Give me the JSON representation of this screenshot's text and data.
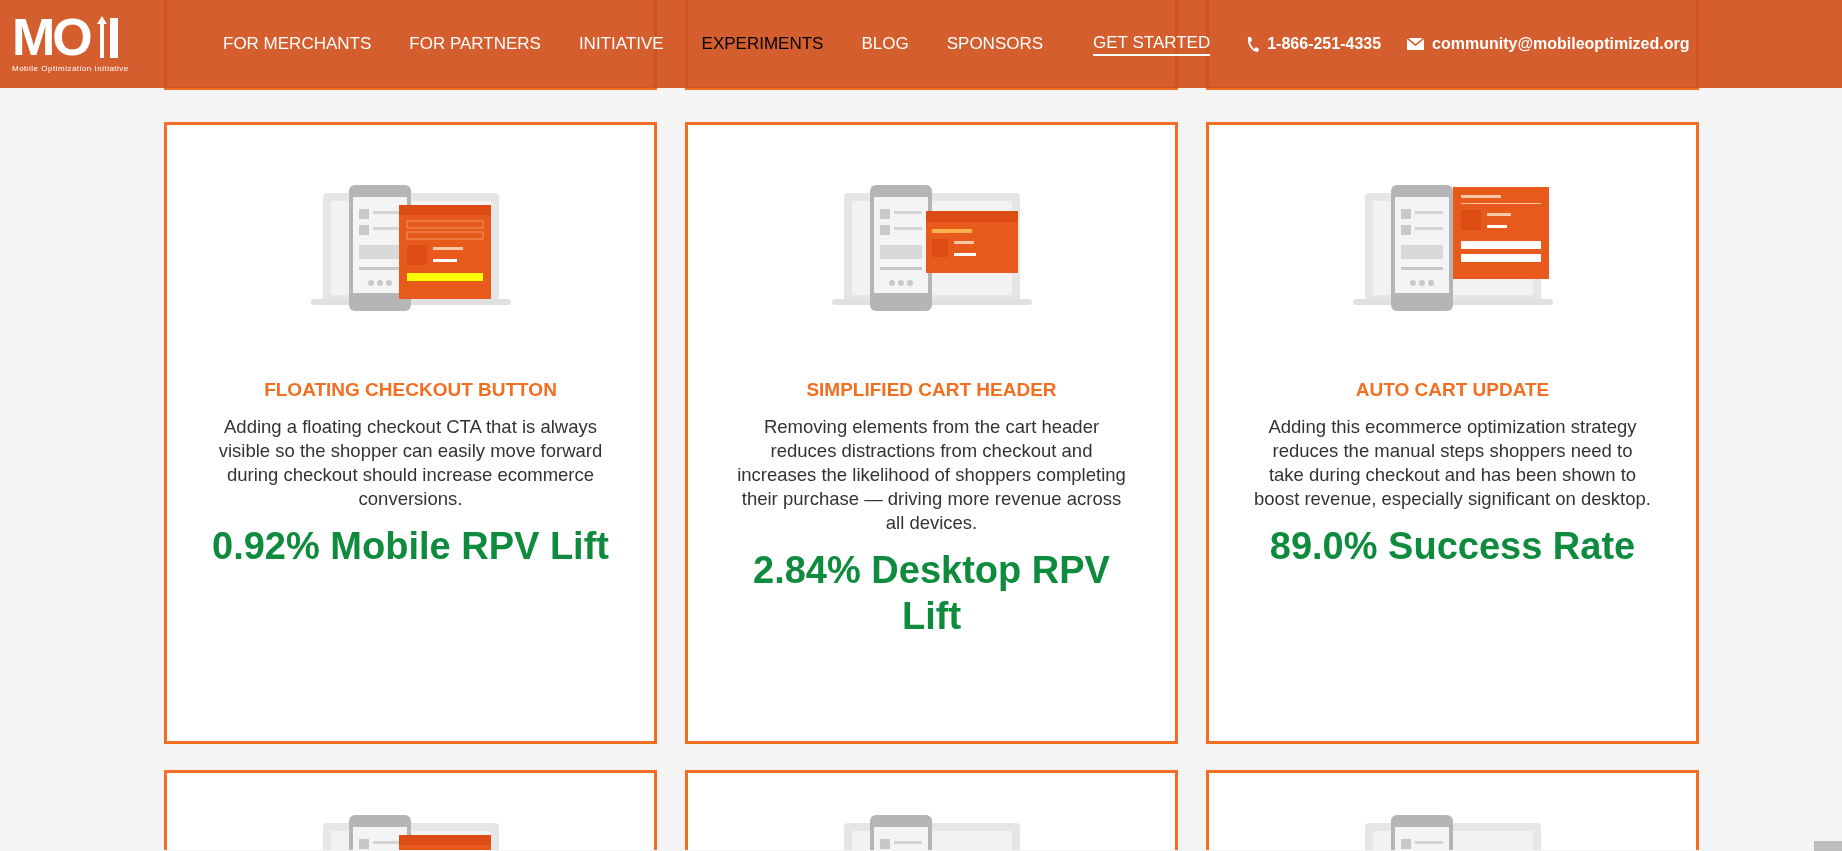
{
  "header": {
    "logo": {
      "wordmark": "MO",
      "tagline": "Mobile Optimization Initiative"
    },
    "nav": [
      {
        "label": "FOR MERCHANTS",
        "kind": "link",
        "selected": false
      },
      {
        "label": "FOR PARTNERS",
        "kind": "link",
        "selected": false
      },
      {
        "label": "INITIATIVE",
        "kind": "link",
        "selected": false
      },
      {
        "label": "EXPERIMENTS",
        "kind": "link",
        "selected": true
      },
      {
        "label": "BLOG",
        "kind": "link",
        "selected": false
      },
      {
        "label": "SPONSORS",
        "kind": "link",
        "selected": false
      },
      {
        "label": "GET STARTED",
        "kind": "cta",
        "selected": false
      }
    ],
    "contact": [
      {
        "kind": "phone",
        "text": "1-866-251-4335"
      },
      {
        "kind": "email",
        "text": "community@mobileoptimized.org"
      }
    ]
  },
  "cards": [
    {
      "kind": "floating-cta",
      "title": "FLOATING CHECKOUT BUTTON",
      "description": "Adding a floating checkout CTA that is always visible so the shopper can easily move forward during checkout should increase ecommerce conversions.",
      "result": "0.92% Mobile RPV Lift"
    },
    {
      "kind": "cart-header",
      "title": "SIMPLIFIED CART HEADER",
      "description": "Removing elements from the cart header reduces distractions from checkout and increases the likelihood of shoppers completing their purchase — driving more revenue across all devices.",
      "result": "2.84% Desktop RPV Lift"
    },
    {
      "kind": "cart-update",
      "title": "AUTO CART UPDATE",
      "description": "Adding this ecommerce optimization strategy reduces the manual steps shoppers need to take during checkout and has been shown to boost revenue, especially significant on desktop.",
      "result": "89.0% Success Rate"
    }
  ],
  "cards_below": [
    {
      "kind": "cart-header-orange"
    },
    {
      "kind": "plain"
    },
    {
      "kind": "plain"
    }
  ]
}
